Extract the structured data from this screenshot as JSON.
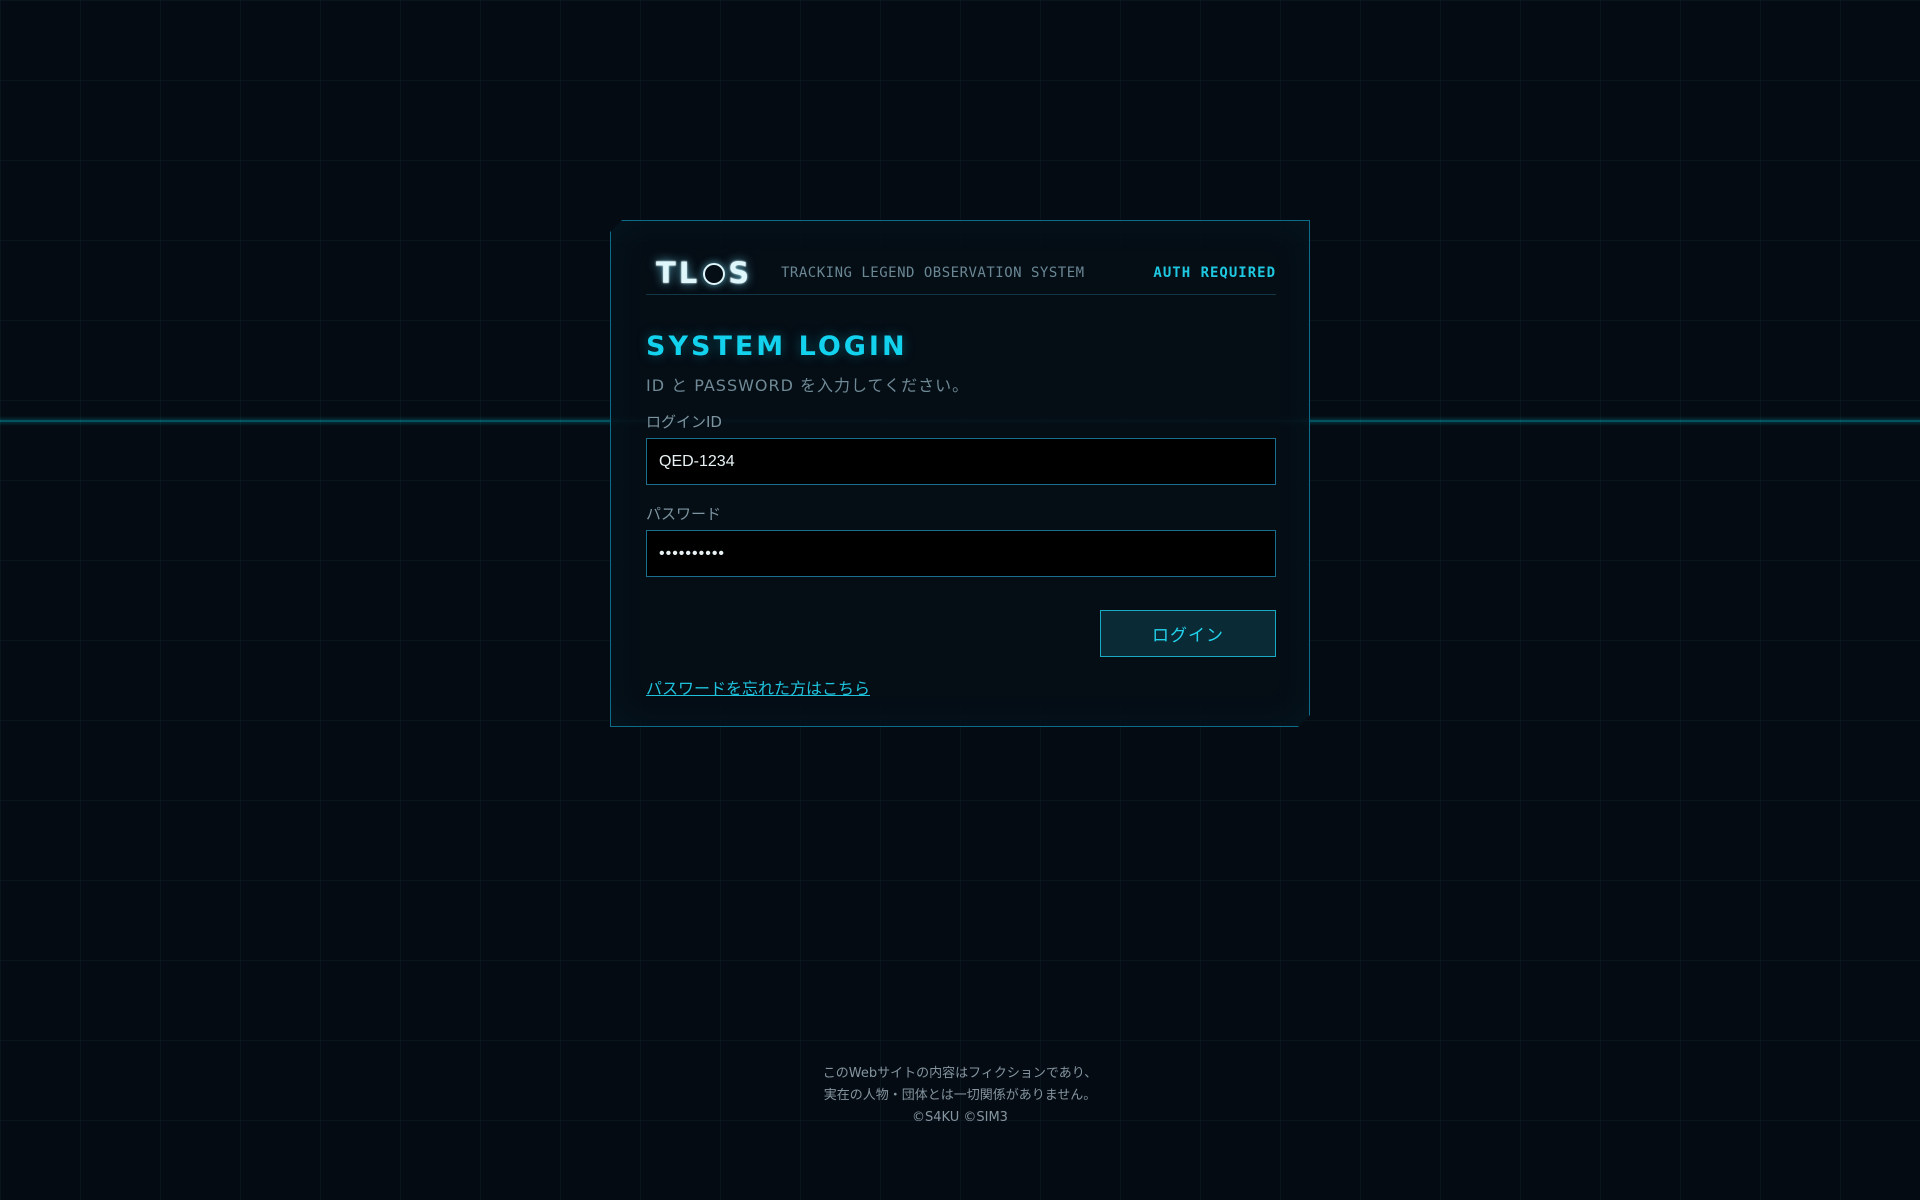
{
  "header": {
    "logo_text_left": "TL",
    "logo_text_right": "S",
    "system_name": "TRACKING LEGEND OBSERVATION SYSTEM",
    "auth_status": "AUTH REQUIRED"
  },
  "login": {
    "title": "SYSTEM LOGIN",
    "subtitle": "ID と PASSWORD を入力してください。",
    "id_label": "ログインID",
    "id_value": "QED-1234",
    "password_label": "パスワード",
    "password_value": "••••••••••",
    "submit_label": "ログイン",
    "forgot_link": "パスワードを忘れた方はこちら"
  },
  "footer": {
    "line1": "このWebサイトの内容はフィクションであり、",
    "line2": "実在の人物・団体とは一切関係がありません。",
    "copyright": "©S4KU ©SIM3"
  },
  "colors": {
    "accent": "#12d2ee",
    "background": "#050b12",
    "border": "#0e6c8a"
  }
}
